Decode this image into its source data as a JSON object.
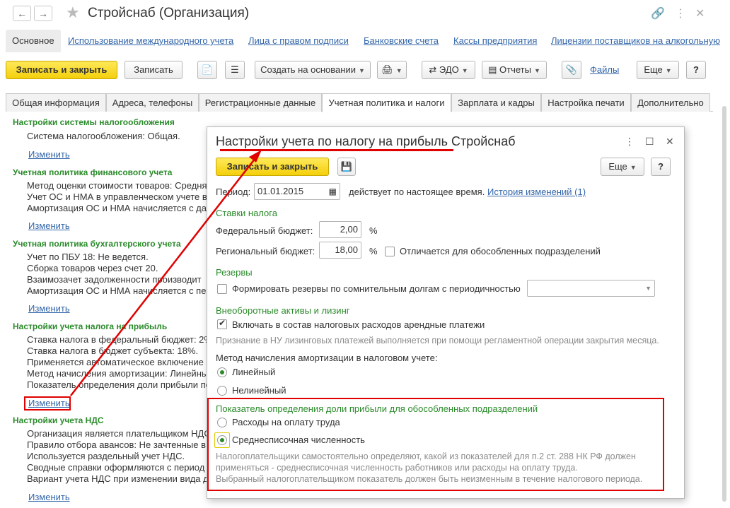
{
  "window": {
    "title": "Стройснаб (Организация)",
    "nav_back": "←",
    "nav_forward": "→"
  },
  "nav": {
    "active": "Основное",
    "links": [
      "Использование международного учета",
      "Лица с правом подписи",
      "Банковские счета",
      "Кассы предприятия",
      "Лицензии поставщиков на алкогольную"
    ]
  },
  "toolbar": {
    "save_close": "Записать и закрыть",
    "save": "Записать",
    "create_based": "Создать на основании",
    "edo": "ЭДО",
    "reports": "Отчеты",
    "files": "Файлы",
    "more": "Еще",
    "help": "?"
  },
  "tabs": [
    "Общая информация",
    "Адреса, телефоны",
    "Регистрационные данные",
    "Учетная политика и налоги",
    "Зарплата и кадры",
    "Настройка печати",
    "Дополнительно"
  ],
  "left": {
    "change": "Изменить",
    "s1": {
      "title": "Настройки системы налогообложения",
      "lines": [
        "Система налогообложения: Общая."
      ]
    },
    "s2": {
      "title": "Учетная политика финансового учета",
      "lines": [
        "Метод оценки стоимости товаров: Средняя",
        "Учет ОС и НМА в управленческом учете в",
        "Амортизация ОС и НМА начисляется с да"
      ]
    },
    "s3": {
      "title": "Учетная политика бухгалтерского учета",
      "lines": [
        "Учет по ПБУ 18: Не ведется.",
        "Сборка товаров через счет 20.",
        "Взаимозачет задолженности производит",
        "Амортизация ОС и НМА начисляется с пе"
      ]
    },
    "s4": {
      "title": "Настройки учета налога на прибыль",
      "lines": [
        "Ставка налога в федеральный бюджет: 2%",
        "Ставка налога в бюджет субъекта: 18%.",
        "Применяется автоматическое включение н",
        "Метод начисления амортизации: Линейны",
        "Показатель определения доли прибыли по"
      ]
    },
    "s5": {
      "title": "Настройки учета НДС",
      "lines": [
        "Организация является плательщиком НДС",
        "Правило отбора авансов: Не зачтенные в",
        "Используется раздельный учет НДС.",
        "Сводные справки оформляются с период",
        "Вариант учета НДС при изменении вида д"
      ]
    }
  },
  "dialog": {
    "title": "Настройки учета по налогу на прибыль Стройснаб",
    "save_close": "Записать и закрыть",
    "more": "Еще",
    "help": "?",
    "period_label": "Период:",
    "period_value": "01.01.2015",
    "period_status": "действует по настоящее время.",
    "history_link": "История изменений (1)",
    "rates_title": "Ставки налога",
    "federal_label": "Федеральный бюджет:",
    "federal_value": "2,00",
    "regional_label": "Региональный бюджет:",
    "regional_value": "18,00",
    "percent": "%",
    "differs_label": "Отличается для обособленных подразделений",
    "reserves_title": "Резервы",
    "reserves_label": "Формировать резервы по сомнительным долгам с периодичностью",
    "assets_title": "Внеоборотные активы и лизинг",
    "lease_label": "Включать в состав налоговых расходов арендные платежи",
    "leasing_hint": "Признание в НУ лизинговых платежей выполняется при помощи регламентной операции закрытия месяца.",
    "method_label": "Метод начисления амортизации в налоговом учете:",
    "linear": "Линейный",
    "nonlinear": "Нелинейный",
    "share_title": "Показатель определения доли прибыли для обособленных подразделений",
    "labor_costs": "Расходы на оплату труда",
    "avg_headcount": "Среднесписочная численность",
    "share_hint_1": "Налогоплательщики самостоятельно определяют, какой из показателей для п.2 ст. 288 НК РФ должен",
    "share_hint_2": "применяться - среднесписочная численность работников или расходы на оплату труда.",
    "share_hint_3": "Выбранный налогоплательщиком показатель должен быть неизменным в течение налогового периода."
  },
  "colors": {
    "accent_red": "#e00000",
    "section_green": "#2a8a2a",
    "link_blue": "#3366aa",
    "button_yellow": "#f3cf0b"
  },
  "icons": [
    "star-icon",
    "link-icon",
    "menu-dots-icon",
    "maximize-icon",
    "close-icon",
    "calendar-icon",
    "floppy-icon",
    "paperclip-icon",
    "document-icon",
    "list-icon",
    "edo-icon",
    "reports-icon"
  ]
}
